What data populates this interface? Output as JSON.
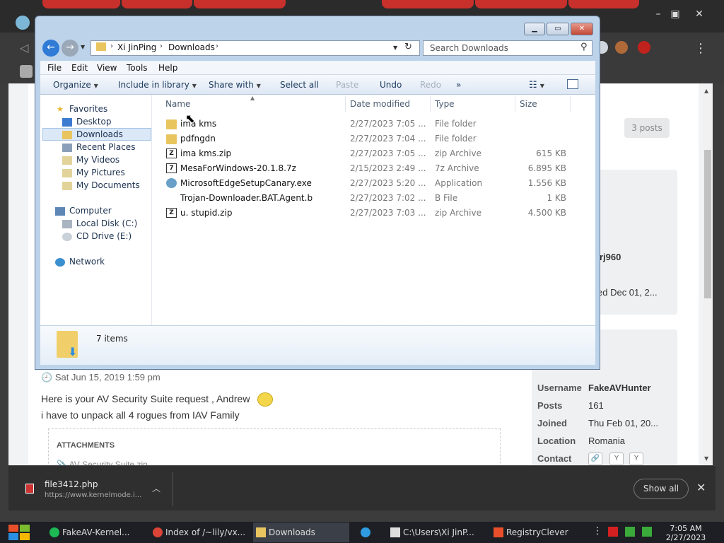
{
  "explorer": {
    "address": {
      "root": "Xi JinPing",
      "folder": "Downloads"
    },
    "search_placeholder": "Search Downloads",
    "menu": [
      "File",
      "Edit",
      "View",
      "Tools",
      "Help"
    ],
    "commands": {
      "organize": "Organize",
      "include": "Include in library",
      "share": "Share with",
      "select_all": "Select all",
      "paste": "Paste",
      "undo": "Undo",
      "redo": "Redo",
      "more": "»"
    },
    "nav": {
      "favorites": "Favorites",
      "desktop": "Desktop",
      "downloads": "Downloads",
      "recent": "Recent Places",
      "videos": "My Videos",
      "pictures": "My Pictures",
      "documents": "My Documents",
      "computer": "Computer",
      "local_disk": "Local Disk (C:)",
      "cd_drive": "CD Drive (E:)",
      "network": "Network"
    },
    "columns": {
      "name": "Name",
      "date": "Date modified",
      "type": "Type",
      "size": "Size"
    },
    "files": [
      {
        "name": "ima kms",
        "date": "2/27/2023 7:05 ...",
        "type": "File folder",
        "size": "",
        "icon": "folder"
      },
      {
        "name": "pdfngdn",
        "date": "2/27/2023 7:04 ...",
        "type": "File folder",
        "size": "",
        "icon": "folder"
      },
      {
        "name": "ima kms.zip",
        "date": "2/27/2023 7:05 ...",
        "type": "zip Archive",
        "size": "615 KB",
        "icon": "zip"
      },
      {
        "name": "MesaForWindows-20.1.8.7z",
        "date": "2/15/2023 2:49 ...",
        "type": "7z Archive",
        "size": "6.895 KB",
        "icon": "zip"
      },
      {
        "name": "MicrosoftEdgeSetupCanary.exe",
        "date": "2/27/2023 5:20 ...",
        "type": "Application",
        "size": "1.556 KB",
        "icon": "exe"
      },
      {
        "name": "Trojan-Downloader.BAT.Agent.b",
        "date": "2/27/2023 7:02 ...",
        "type": "B File",
        "size": "1 KB",
        "icon": "none"
      },
      {
        "name": "u. stupid.zip",
        "date": "2/27/2023 7:03 ...",
        "type": "zip Archive",
        "size": "4.500 KB",
        "icon": "zip"
      }
    ],
    "item_count": "7 items"
  },
  "forum": {
    "posts_badge": "3 posts",
    "side_name_frag": "rj960",
    "side_date_frag": "ed Dec 01, 2...",
    "post_date": "Sat Jun 15, 2019 1:59 pm",
    "post_line1": "Here is your AV Security Suite request , Andrew",
    "post_line2": "i have to unpack all 4 rogues from IAV Family",
    "attachments_title": "ATTACHMENTS",
    "attachment_file": "AV Security Suite.zip",
    "user": {
      "username_label": "Username",
      "username": "FakeAVHunter",
      "posts_label": "Posts",
      "posts": "161",
      "joined_label": "Joined",
      "joined": "Thu Feb 01, 20...",
      "location_label": "Location",
      "location": "Romania",
      "contact_label": "Contact"
    }
  },
  "download": {
    "filename": "file3412.php",
    "url": "https://www.kernelmode.i...",
    "show_all": "Show all"
  },
  "taskbar": {
    "items": [
      "FakeAV-Kernel...",
      "Index of /~lily/vx...",
      "Downloads",
      "C:\\Users\\Xi JinP...",
      "RegistryClever"
    ],
    "time": "7:05 AM",
    "date": "2/27/2023"
  }
}
